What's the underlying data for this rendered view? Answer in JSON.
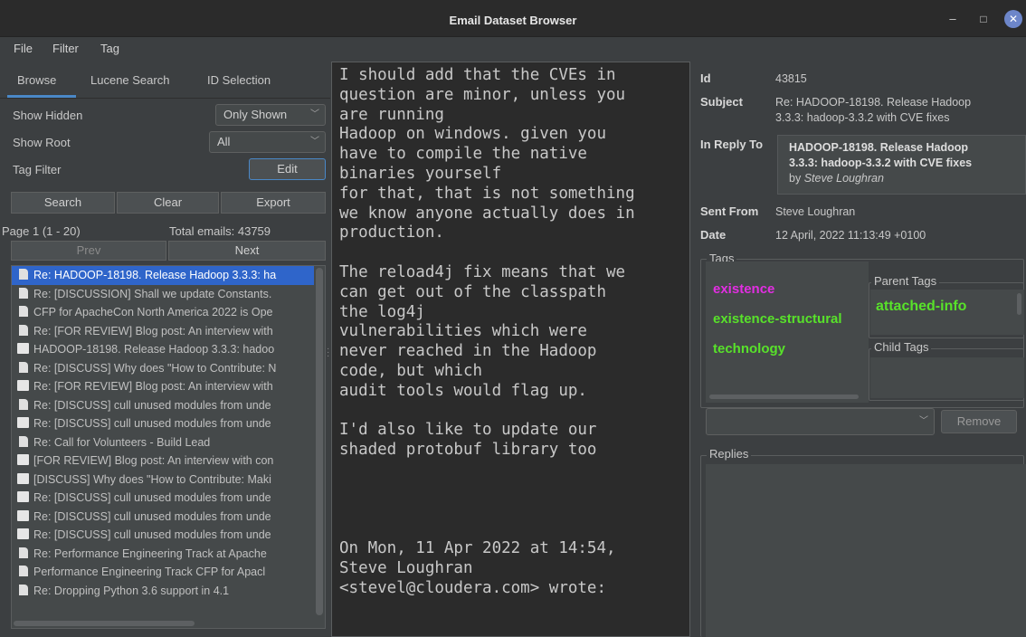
{
  "window": {
    "title": "Email Dataset Browser",
    "min_glyph": "–",
    "max_glyph": "□",
    "close_glyph": "✕"
  },
  "menu": [
    "File",
    "Filter",
    "Tag"
  ],
  "left": {
    "tabs": [
      "Browse",
      "Lucene Search",
      "ID Selection"
    ],
    "show_hidden_label": "Show Hidden",
    "show_hidden_value": "Only Shown",
    "show_root_label": "Show Root",
    "show_root_value": "All",
    "tag_filter_label": "Tag Filter",
    "edit_label": "Edit",
    "search_label": "Search",
    "clear_label": "Clear",
    "export_label": "Export",
    "page_info": "Page 1 (1 - 20)",
    "total_emails": "Total emails: 43759",
    "prev_label": "Prev",
    "next_label": "Next",
    "emails": [
      {
        "icon": "doc",
        "text": "Re: HADOOP-18198. Release Hadoop 3.3.3: ha"
      },
      {
        "icon": "doc",
        "text": "Re: [DISCUSSION] Shall we update Constants."
      },
      {
        "icon": "doc",
        "text": "CFP for ApacheCon North America 2022 is Ope"
      },
      {
        "icon": "doc",
        "text": "Re: [FOR REVIEW] Blog post: An interview with"
      },
      {
        "icon": "folder",
        "text": "HADOOP-18198. Release Hadoop 3.3.3: hadoo"
      },
      {
        "icon": "doc",
        "text": "Re: [DISCUSS] Why does \"How to Contribute: N"
      },
      {
        "icon": "folder",
        "text": "Re: [FOR REVIEW] Blog post: An interview with"
      },
      {
        "icon": "doc",
        "text": "Re: [DISCUSS] cull unused modules from unde"
      },
      {
        "icon": "folder",
        "text": "Re: [DISCUSS] cull unused modules from unde"
      },
      {
        "icon": "doc",
        "text": "Re: Call for Volunteers - Build Lead"
      },
      {
        "icon": "folder",
        "text": "[FOR REVIEW] Blog post: An interview with con"
      },
      {
        "icon": "folder",
        "text": "[DISCUSS] Why does \"How to Contribute: Maki"
      },
      {
        "icon": "folder",
        "text": "Re: [DISCUSS] cull unused modules from unde"
      },
      {
        "icon": "folder",
        "text": "Re: [DISCUSS] cull unused modules from unde"
      },
      {
        "icon": "folder",
        "text": "Re: [DISCUSS] cull unused modules from unde"
      },
      {
        "icon": "doc",
        "text": "Re: Performance Engineering Track at Apache"
      },
      {
        "icon": "doc",
        "text": "Performance Engineering Track CFP for Apacl"
      },
      {
        "icon": "doc",
        "text": "Re: Dropping Python 3.6 support in 4.1"
      }
    ]
  },
  "body_text": "I should add that the CVEs in\nquestion are minor, unless you\nare running\nHadoop on windows. given you\nhave to compile the native\nbinaries yourself\nfor that, that is not something\nwe know anyone actually does in\nproduction.\n\nThe reload4j fix means that we\ncan get out of the classpath\nthe log4j\nvulnerabilities which were\nnever reached in the Hadoop\ncode, but which\naudit tools would flag up.\n\nI'd also like to update our\nshaded protobuf library too\n\n\n\n\nOn Mon, 11 Apr 2022 at 14:54,\nSteve Loughran\n<stevel@cloudera.com> wrote:",
  "details": {
    "id_label": "Id",
    "id_value": "43815",
    "subject_label": "Subject",
    "subject_line1": "Re: HADOOP-18198. Release Hadoop",
    "subject_line2": "3.3.3: hadoop-3.3.2 with CVE fixes",
    "in_reply_to_label": "In Reply To",
    "reply_title_line1": "HADOOP-18198. Release Hadoop",
    "reply_title_line2": "3.3.3: hadoop-3.3.2 with CVE fixes",
    "reply_by_prefix": "by ",
    "reply_by_author": "Steve Loughran",
    "sent_from_label": "Sent From",
    "sent_from_value": "Steve Loughran",
    "date_label": "Date",
    "date_value": "12 April, 2022 11:13:49 +0100",
    "tags_label": "Tags",
    "tags": [
      {
        "name": "existence",
        "color": "#e22ee2"
      },
      {
        "name": "existence-structural",
        "color": "#58e22a"
      },
      {
        "name": "technology",
        "color": "#58e22a"
      }
    ],
    "parent_tags_label": "Parent Tags",
    "parent_tags": [
      "attached-info"
    ],
    "child_tags_label": "Child Tags",
    "remove_label": "Remove",
    "replies_label": "Replies"
  }
}
